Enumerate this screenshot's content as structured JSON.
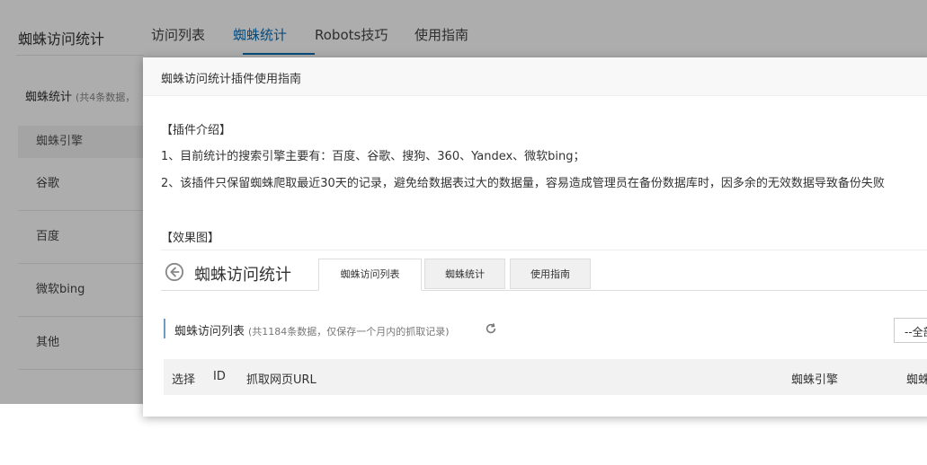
{
  "app": {
    "title": "蜘蛛访问统计"
  },
  "tabs": [
    {
      "label": "访问列表"
    },
    {
      "label": "蜘蛛统计",
      "active": true
    },
    {
      "label": "Robots技巧"
    },
    {
      "label": "使用指南"
    }
  ],
  "stats": {
    "title": "蜘蛛统计",
    "subtitle": "(共4条数据，",
    "header": "蜘蛛引擎",
    "rows": [
      "谷歌",
      "百度",
      "微软bing",
      "其他"
    ]
  },
  "modal": {
    "title": "蜘蛛访问统计插件使用指南",
    "section_intro": "【插件介绍】",
    "line1": "1、目前统计的搜索引擎主要有：百度、谷歌、搜狗、360、Yandex、微软bing；",
    "line2": "2、该插件只保留蜘蛛爬取最近30天的记录，避免给数据表过大的数据量，容易造成管理员在备份数据库时，因多余的无效数据导致备份失败",
    "section_effect": "【效果图】"
  },
  "screenshot": {
    "title": "蜘蛛访问统计",
    "tabs": [
      "蜘蛛访问列表",
      "蜘蛛统计",
      "使用指南"
    ],
    "list_title": "蜘蛛访问列表",
    "list_subtitle": "(共1184条数据，仅保存一个月内的抓取记录)",
    "select_value": "--全部",
    "columns": [
      "选择",
      "ID",
      "抓取网页URL",
      "蜘蛛引擎",
      "蜘蛛"
    ]
  },
  "colors": {
    "accent": "#0b6fb6",
    "overlay": "rgba(0,0,0,0.32)"
  },
  "icons": {
    "back": "back-arrow-circle-icon",
    "refresh": "refresh-icon"
  }
}
